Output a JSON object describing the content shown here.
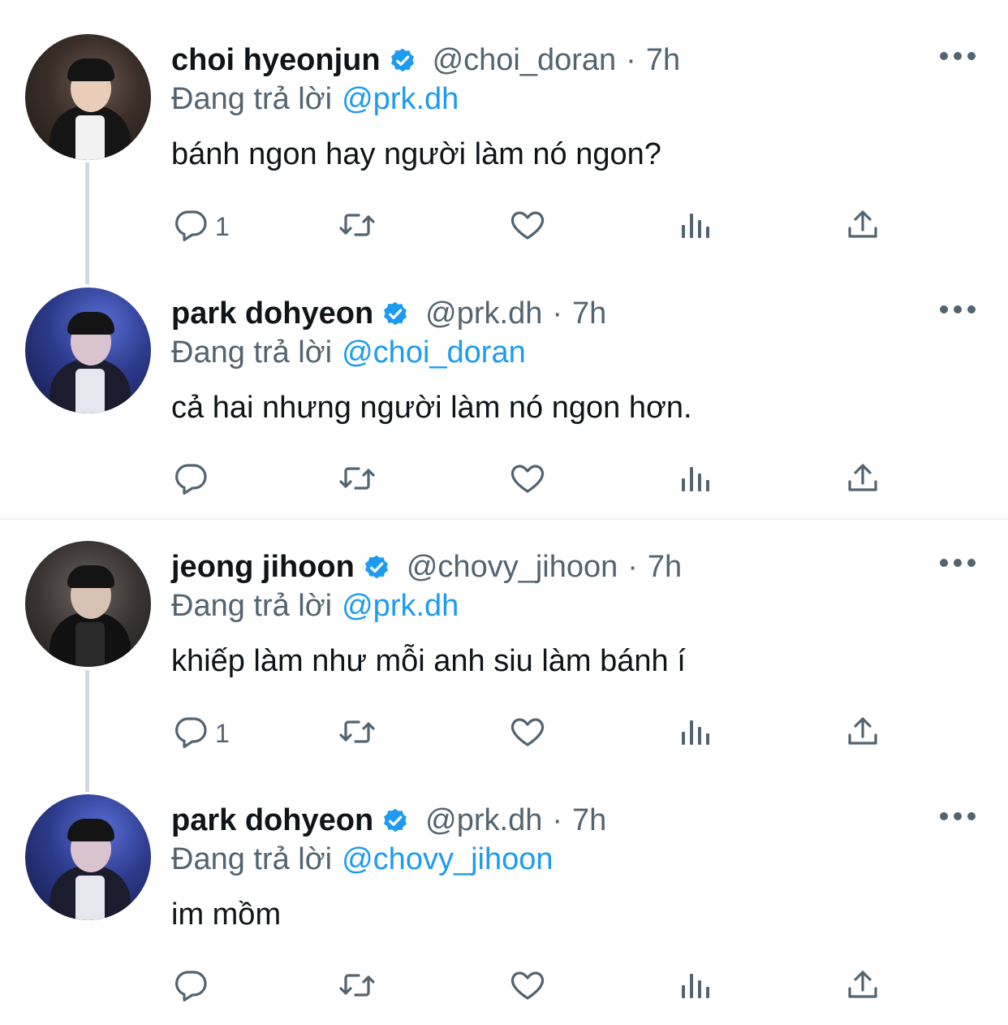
{
  "colors": {
    "accent": "#1d9bf0",
    "secondary_text": "#536471",
    "primary_text": "#0f1419",
    "thread_line": "#cfd9de"
  },
  "reply_label": "Đang trả lời",
  "threads": [
    {
      "tweets": [
        {
          "name": "choi hyeonjun",
          "verified": true,
          "handle": "@choi_doran",
          "time": "7h",
          "replying_to": "@prk.dh",
          "text": "bánh ngon hay người làm nó ngon?",
          "reply_count": "1",
          "avatar": "avatar-choi-hyeonjun"
        },
        {
          "name": "park dohyeon",
          "verified": true,
          "handle": "@prk.dh",
          "time": "7h",
          "replying_to": "@choi_doran",
          "text": "cả hai nhưng người làm nó ngon hơn.",
          "reply_count": "",
          "avatar": "avatar-park-dohyeon"
        }
      ]
    },
    {
      "tweets": [
        {
          "name": "jeong jihoon",
          "verified": true,
          "handle": "@chovy_jihoon",
          "time": "7h",
          "replying_to": "@prk.dh",
          "text": "khiếp làm như mỗi anh siu làm bánh í",
          "reply_count": "1",
          "avatar": "avatar-jeong-jihoon"
        },
        {
          "name": "park dohyeon",
          "verified": true,
          "handle": "@prk.dh",
          "time": "7h",
          "replying_to": "@chovy_jihoon",
          "text": "im mồm",
          "reply_count": "",
          "avatar": "avatar-park-dohyeon"
        }
      ]
    }
  ],
  "icons": {
    "reply": "reply-icon",
    "retweet": "retweet-icon",
    "like": "heart-icon",
    "views": "views-icon",
    "share": "share-icon",
    "more": "more-icon",
    "verified": "verified-badge-icon"
  }
}
